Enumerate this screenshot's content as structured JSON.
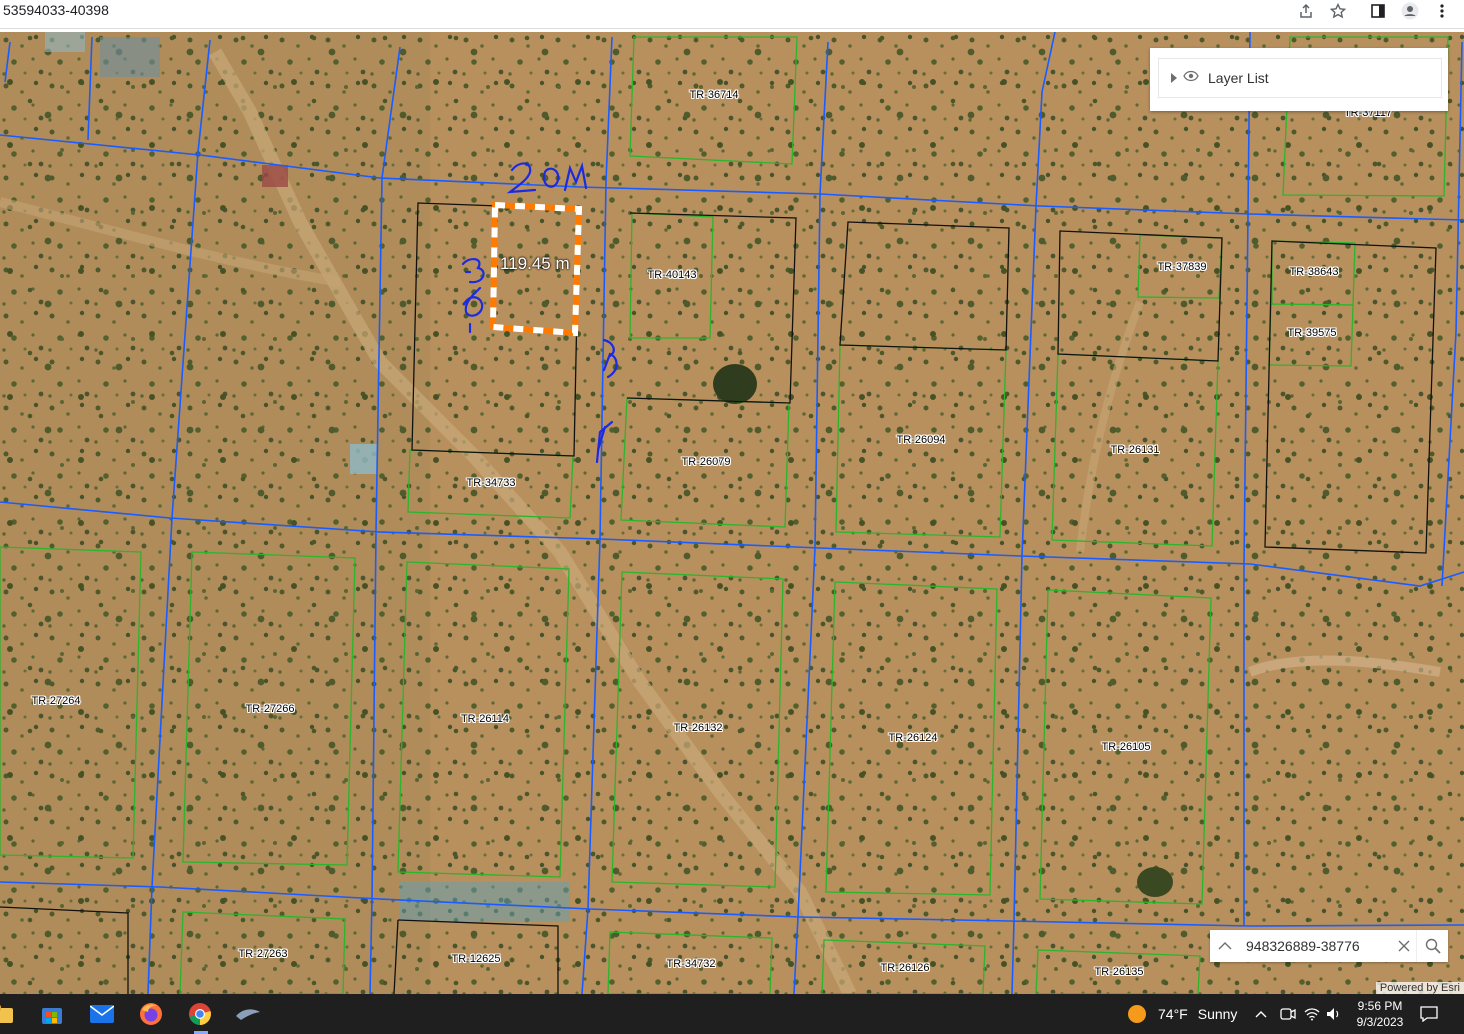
{
  "browser": {
    "url_fragment": "53594033-40398"
  },
  "map": {
    "parcels": [
      "TR-36714",
      "TR-37117",
      "TR-40143",
      "TR-37839",
      "TR-38643",
      "TR-39575",
      "TR-26094",
      "TR-26131",
      "TR-26079",
      "TR-34733",
      "TR-27264",
      "TR-27266",
      "TR-26114",
      "TR-26132",
      "TR-26124",
      "TR-26105",
      "TR-27263",
      "TR-12625",
      "TR-34732",
      "TR-26126",
      "TR-26135"
    ],
    "measurement": "119.45 m",
    "annotations": {
      "top": "20M",
      "left": "36M",
      "right": "45"
    },
    "layer_list_label": "Layer List",
    "search_value": "948326889-38776",
    "attribution": "Powered by Esri",
    "colors": {
      "road_line": "#1a5cff",
      "parcel_green": "#2bb52b",
      "parcel_black": "#111111",
      "measure_orange": "#ff7a00",
      "ink_blue": "#1d2be0"
    }
  },
  "taskbar": {
    "weather_temp": "74°F",
    "weather_text": "Sunny",
    "time": "9:56 PM",
    "date": "9/3/2023"
  }
}
